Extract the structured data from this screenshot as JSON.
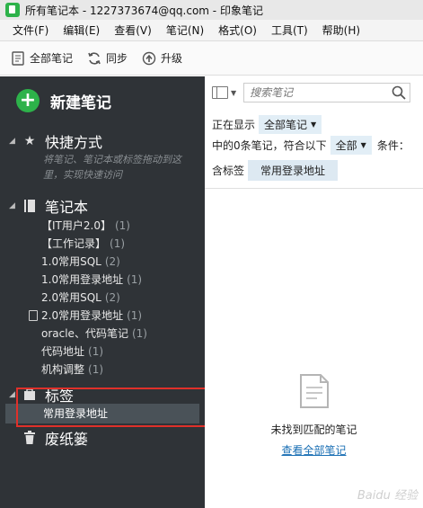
{
  "window": {
    "title": "所有笔记本 - 1227373674@qq.com - 印象笔记"
  },
  "menu": [
    {
      "label": "文件(F)"
    },
    {
      "label": "编辑(E)"
    },
    {
      "label": "查看(V)"
    },
    {
      "label": "笔记(N)"
    },
    {
      "label": "格式(O)"
    },
    {
      "label": "工具(T)"
    },
    {
      "label": "帮助(H)"
    }
  ],
  "toolbar": {
    "all_notes": "全部笔记",
    "sync": "同步",
    "upgrade": "升级"
  },
  "sidebar": {
    "new_note": "新建笔记",
    "shortcuts": {
      "label": "快捷方式",
      "hint": "将笔记、笔记本或标签拖动到这里，实现快速访问"
    },
    "notebooks": {
      "label": "笔记本",
      "items": [
        {
          "name": "【IT用户2.0】",
          "count": "(1)"
        },
        {
          "name": "【工作记录】",
          "count": "(1)"
        },
        {
          "name": "1.0常用SQL",
          "count": "(2)"
        },
        {
          "name": "1.0常用登录地址",
          "count": "(1)"
        },
        {
          "name": "2.0常用SQL",
          "count": "(2)"
        },
        {
          "name": "2.0常用登录地址",
          "count": "(1)"
        },
        {
          "name": "oracle、代码笔记",
          "count": "(1)"
        },
        {
          "name": "代码地址",
          "count": "(1)"
        },
        {
          "name": "机构调整",
          "count": "(1)"
        }
      ]
    },
    "tags": {
      "label": "标签",
      "selected": "常用登录地址"
    },
    "trash": {
      "label": "废纸篓"
    }
  },
  "main": {
    "search_placeholder": "搜索笔记",
    "showing_label": "正在显示",
    "showing_value": "全部笔记",
    "match_prefix": "中的0条笔记，符合以下",
    "match_value": "全部",
    "match_suffix": "条件：",
    "tag_label": "含标签",
    "tag_value": "常用登录地址",
    "empty_message": "未找到匹配的笔记",
    "view_all_link": "查看全部笔记"
  },
  "watermark": "Baidu 经验",
  "colors": {
    "sidebar_bg": "#2f3337",
    "accent_green": "#2db24a",
    "highlight_red": "#e0302a",
    "link_blue": "#1a6fb4"
  }
}
